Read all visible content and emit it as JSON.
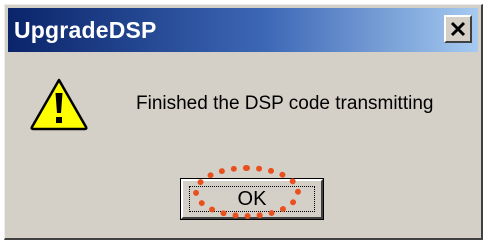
{
  "window": {
    "title": "UpgradeDSP",
    "close_icon": "close-icon"
  },
  "message": {
    "icon": "warning-icon",
    "text": "Finished the DSP code transmitting"
  },
  "buttons": {
    "ok_label": "OK"
  },
  "annotation": {
    "highlight_color": "#e8501e"
  }
}
